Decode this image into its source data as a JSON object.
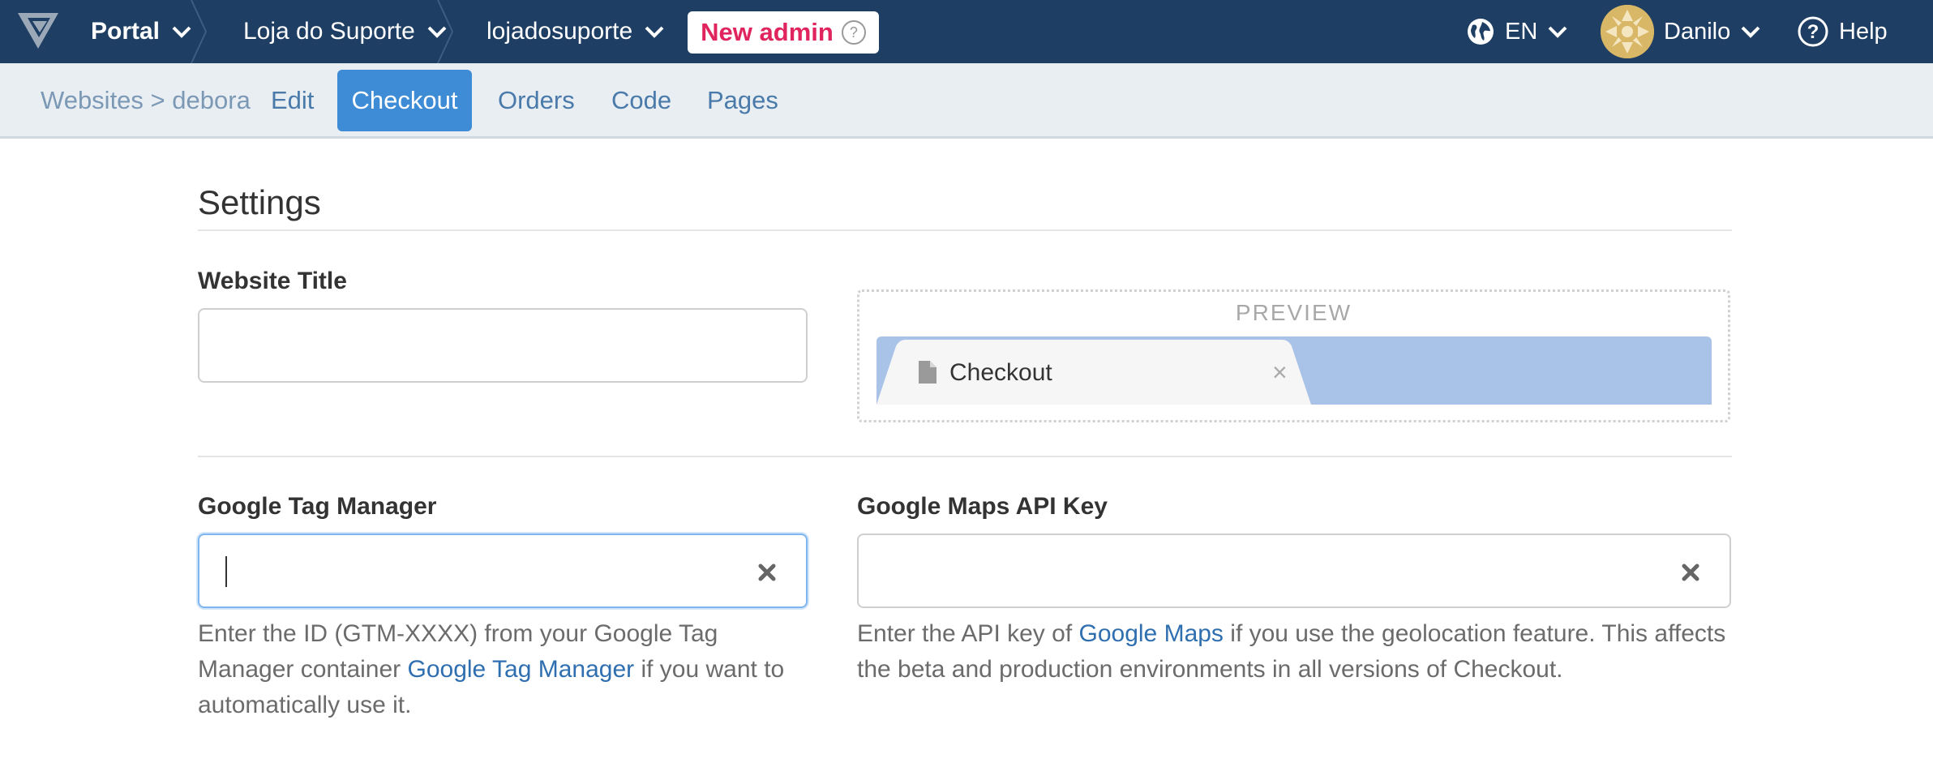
{
  "topbar": {
    "portal": "Portal",
    "account": "Loja do Suporte",
    "store": "lojadosuporte",
    "new_admin": "New admin",
    "language": "EN",
    "user": "Danilo",
    "help": "Help"
  },
  "subnav": {
    "breadcrumb_websites": "Websites",
    "breadcrumb_sep": ">",
    "breadcrumb_site": "debora",
    "tabs": [
      "Edit",
      "Checkout",
      "Orders",
      "Code",
      "Pages"
    ],
    "active_tab": "Checkout"
  },
  "settings": {
    "heading": "Settings",
    "website_title": {
      "label": "Website Title",
      "value": ""
    },
    "preview": {
      "label": "PREVIEW",
      "tab_title": "Checkout",
      "close_glyph": "×"
    },
    "gtm": {
      "label": "Google Tag Manager",
      "value": "",
      "help_before": "Enter the ID (GTM-XXXX) from your Google Tag Manager container ",
      "help_link": "Google Tag Manager",
      "help_after": " if you want to automatically use it."
    },
    "maps": {
      "label": "Google Maps API Key",
      "value": "",
      "help_before": "Enter the API key of ",
      "help_link": "Google Maps",
      "help_after": " if you use the geolocation feature. This affects the beta and production environments in all versions of Checkout."
    }
  },
  "colors": {
    "topbar_bg": "#1e3e63",
    "subnav_bg": "#e9eef3",
    "active_tab_bg": "#3e8bd6",
    "new_admin_text": "#e0245e",
    "link": "#2f6fb0",
    "preview_tabstrip": "#a9c2e8"
  },
  "icons": [
    "vtex-logo-icon",
    "chevron-down-icon",
    "globe-icon",
    "help-circle-icon",
    "question-icon",
    "file-icon",
    "close-icon",
    "clear-icon"
  ]
}
